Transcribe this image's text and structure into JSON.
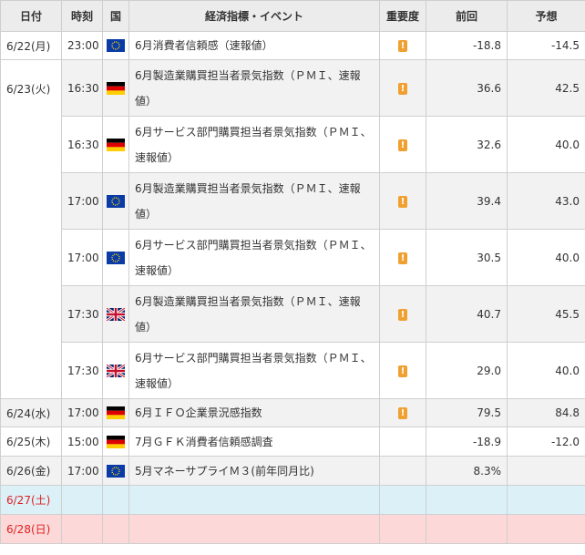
{
  "headers": {
    "date": "日付",
    "time": "時刻",
    "country": "国",
    "event": "経済指標・イベント",
    "importance": "重要度",
    "previous": "前回",
    "forecast": "予想"
  },
  "colors": {
    "importance": "#f0a030",
    "weekend_date": "#d22222",
    "saturday_row": "#dcf0f8",
    "sunday_row": "#fcd8d8",
    "row_alt": "#f2f2f2"
  },
  "dates": [
    {
      "date": "6/22(月)"
    },
    {
      "date": "6/23(火)"
    },
    {
      "date": "6/24(水)"
    },
    {
      "date": "6/25(木)"
    },
    {
      "date": "6/26(金)"
    },
    {
      "date": "6/27(土)"
    },
    {
      "date": "6/28(日)"
    }
  ],
  "events": [
    {
      "time": "23:00",
      "country": "eu-flag-icon",
      "event": "6月消費者信頼感（速報値）",
      "importance_icon": "!",
      "previous": "-18.8",
      "forecast": "-14.5"
    },
    {
      "time": "16:30",
      "country": "germany-flag-icon",
      "event": "6月製造業購買担当者景気指数（ＰＭＩ、速報値）",
      "importance_icon": "!",
      "previous": "36.6",
      "forecast": "42.5"
    },
    {
      "time": "16:30",
      "country": "germany-flag-icon",
      "event": "6月サービス部門購買担当者景気指数（ＰＭＩ、速報値）",
      "importance_icon": "!",
      "previous": "32.6",
      "forecast": "40.0"
    },
    {
      "time": "17:00",
      "country": "eu-flag-icon",
      "event": "6月製造業購買担当者景気指数（ＰＭＩ、速報値）",
      "importance_icon": "!",
      "previous": "39.4",
      "forecast": "43.0"
    },
    {
      "time": "17:00",
      "country": "eu-flag-icon",
      "event": "6月サービス部門購買担当者景気指数（ＰＭＩ、速報値）",
      "importance_icon": "!",
      "previous": "30.5",
      "forecast": "40.0"
    },
    {
      "time": "17:30",
      "country": "uk-flag-icon",
      "event": "6月製造業購買担当者景気指数（ＰＭＩ、速報値）",
      "importance_icon": "!",
      "previous": "40.7",
      "forecast": "45.5"
    },
    {
      "time": "17:30",
      "country": "uk-flag-icon",
      "event": "6月サービス部門購買担当者景気指数（ＰＭＩ、速報値）",
      "importance_icon": "!",
      "previous": "29.0",
      "forecast": "40.0"
    },
    {
      "time": "17:00",
      "country": "germany-flag-icon",
      "event": "6月ＩＦＯ企業景況感指数",
      "importance_icon": "!",
      "previous": "79.5",
      "forecast": "84.8"
    },
    {
      "time": "15:00",
      "country": "germany-flag-icon",
      "event": "7月ＧＦＫ消費者信頼感調査",
      "importance_icon": "",
      "previous": "-18.9",
      "forecast": "-12.0"
    },
    {
      "time": "17:00",
      "country": "eu-flag-icon",
      "event": "5月マネーサプライＭ３(前年同月比)",
      "importance_icon": "",
      "previous": "8.3%",
      "forecast": ""
    }
  ]
}
